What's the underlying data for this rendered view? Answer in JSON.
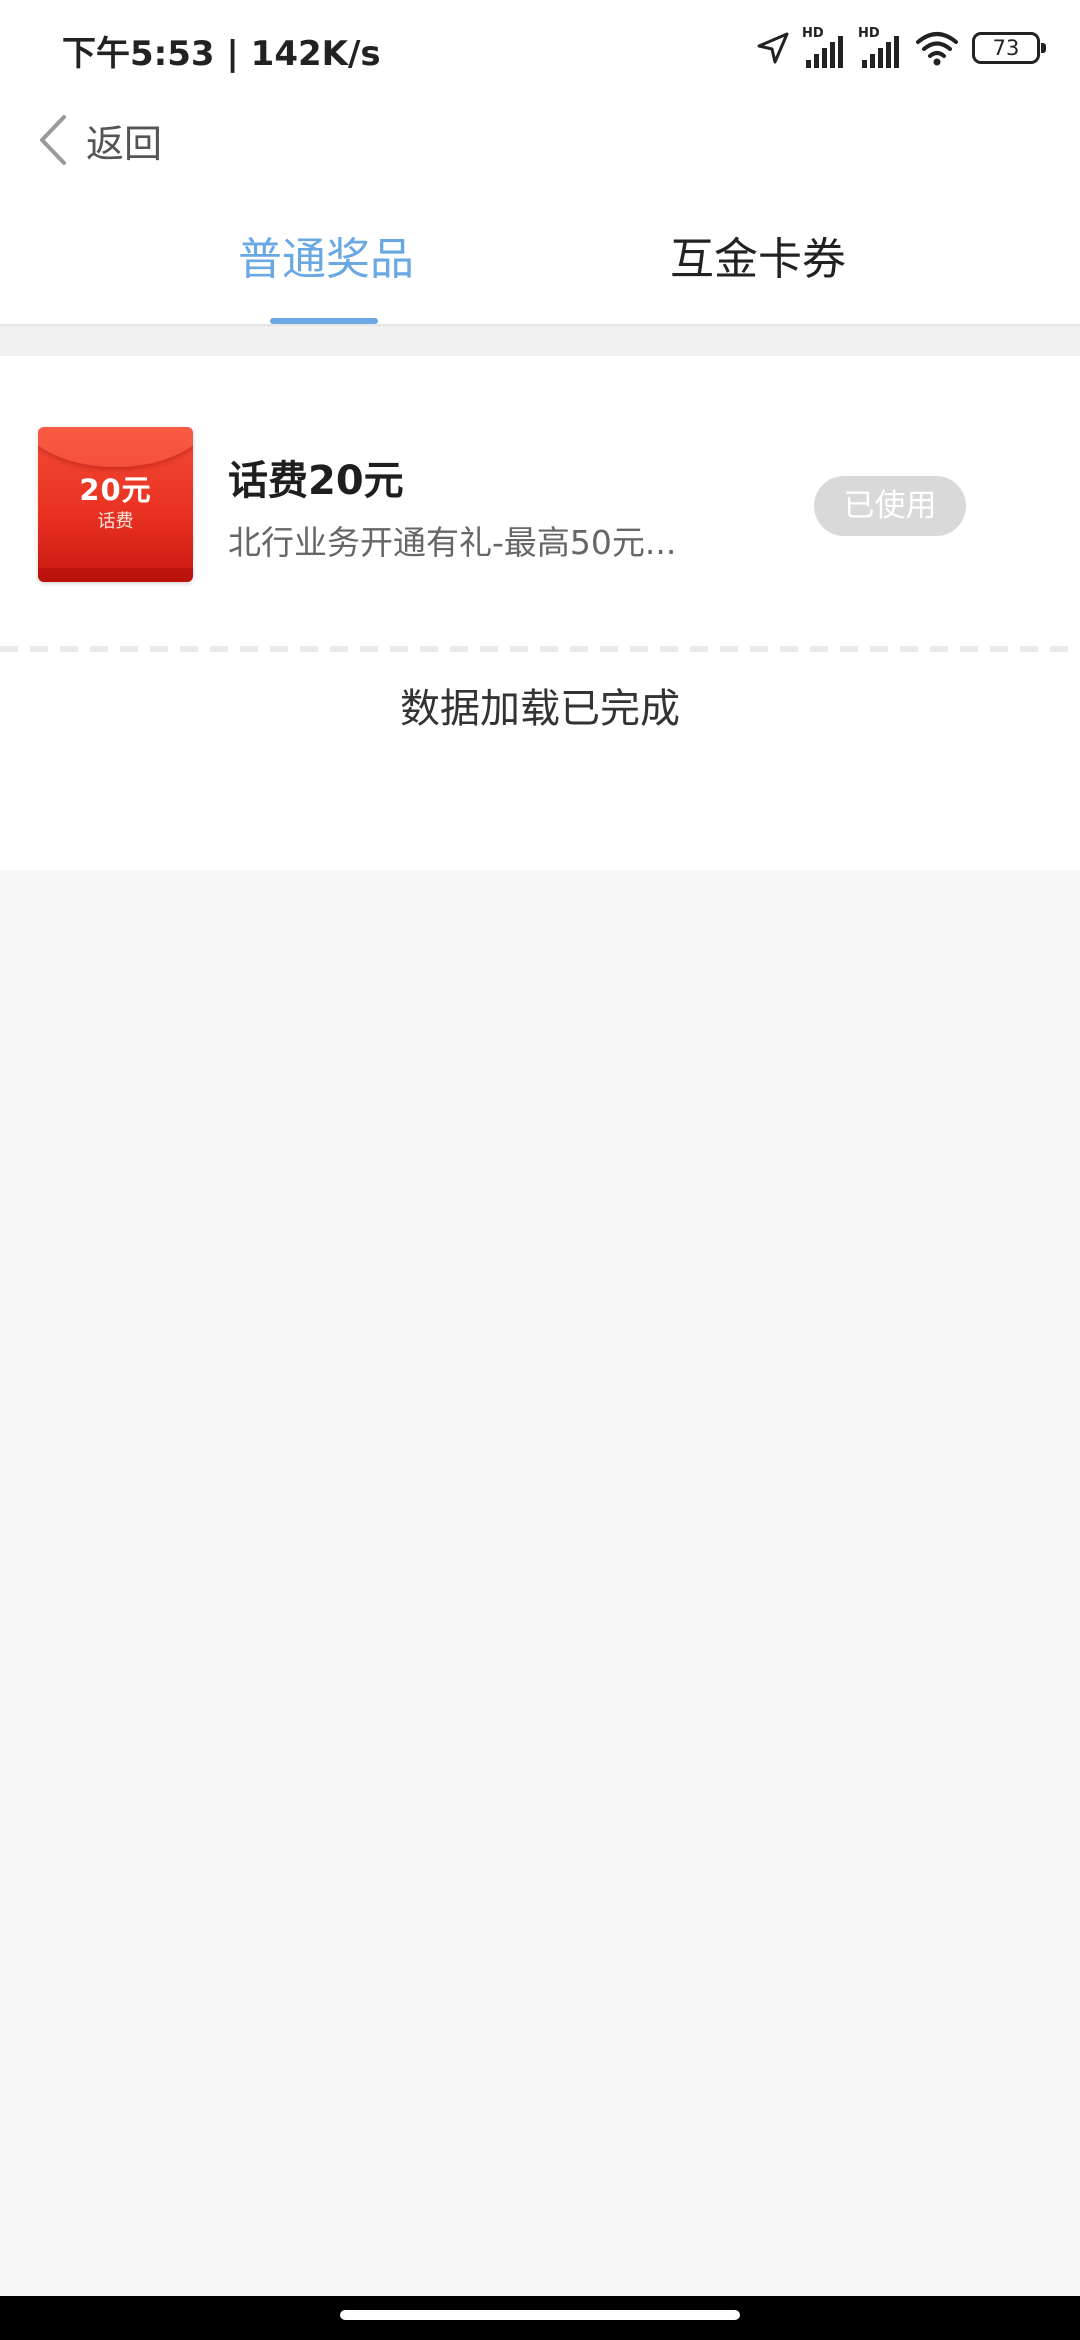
{
  "status_bar": {
    "time": "下午5:53 | 142K/s",
    "battery": "73",
    "signal_label_1": "HD",
    "signal_label_2": "HD",
    "icons": [
      "location-icon",
      "signal-hd-icon",
      "signal-hd-icon",
      "wifi-icon",
      "battery-icon"
    ]
  },
  "nav": {
    "back_label": "返回"
  },
  "tabs": [
    {
      "label": "普通奖品",
      "active": true
    },
    {
      "label": "互金卡券",
      "active": false
    }
  ],
  "prizes": [
    {
      "thumb_amount": "20元",
      "thumb_label": "话费",
      "title": "话费20元",
      "description": "北行业务开通有礼-最高50元...",
      "status": "已使用"
    }
  ],
  "footer": {
    "load_complete": "数据加载已完成"
  },
  "colors": {
    "accent": "#6aa8e4",
    "pill_bg": "#d9d9d9",
    "red_packet": "#e93222"
  }
}
